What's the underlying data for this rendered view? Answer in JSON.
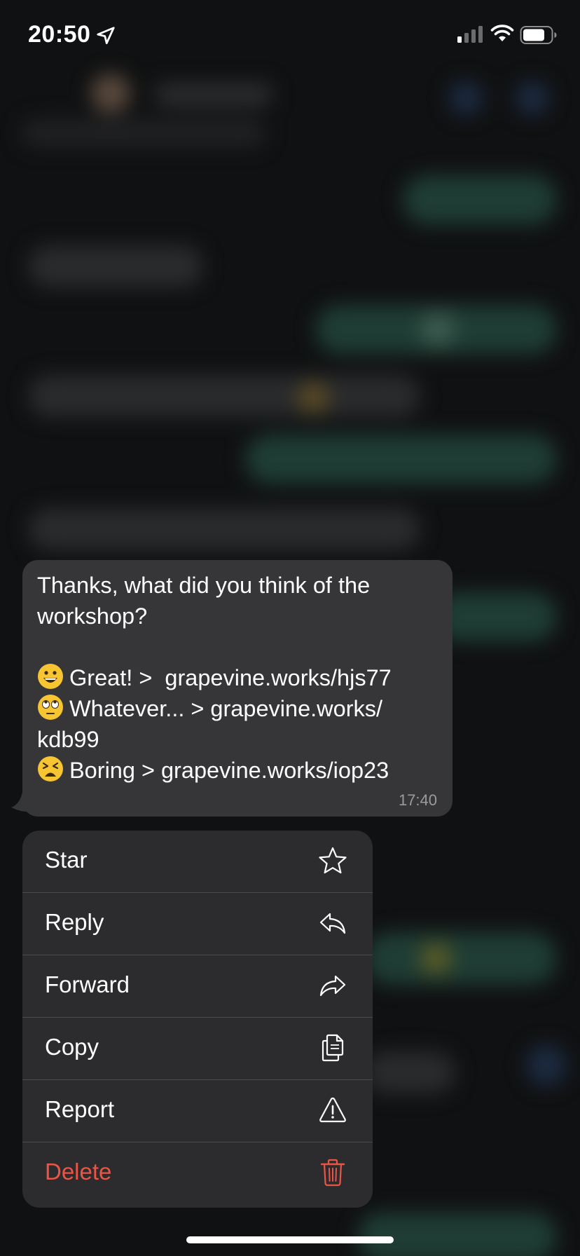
{
  "status_bar": {
    "time": "20:50",
    "icons": [
      "location-arrow-icon",
      "signal-icon",
      "wifi-icon",
      "battery-icon"
    ]
  },
  "message": {
    "line1": "Thanks, what did you think of the workshop?",
    "option_great": "Great! >  grapevine.works/hjs77",
    "option_whatever": "Whatever... > grapevine.works/\nkdb99",
    "option_boring": "Boring > grapevine.works/iop23",
    "time": "17:40",
    "emojis": [
      "grinning-face-icon",
      "rolling-eyes-face-icon",
      "weary-face-icon"
    ]
  },
  "menu": {
    "items": [
      {
        "label": "Star",
        "icon": "star-icon"
      },
      {
        "label": "Reply",
        "icon": "reply-icon"
      },
      {
        "label": "Forward",
        "icon": "forward-icon"
      },
      {
        "label": "Copy",
        "icon": "copy-icon"
      },
      {
        "label": "Report",
        "icon": "warning-icon"
      },
      {
        "label": "Delete",
        "icon": "trash-icon"
      }
    ]
  },
  "colors": {
    "bubble": "#363638",
    "menu": "#2c2c2e",
    "danger": "#eb5545",
    "outgoing_blur": "#1f3d35"
  }
}
